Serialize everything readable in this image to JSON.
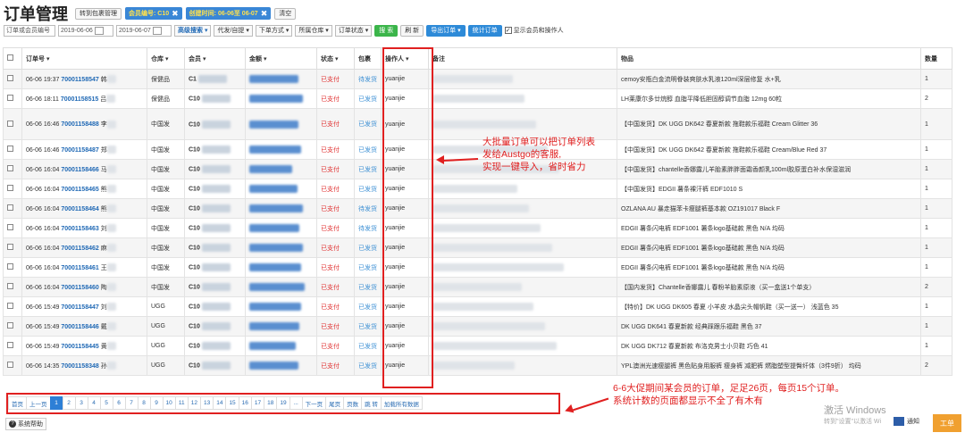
{
  "header": {
    "title": "订单管理",
    "switch_btn": "转到包裹管理",
    "filter_member_label": "会员编号: C10",
    "filter_time_label": "创建时间: 06-06至 06-07",
    "clear_btn": "清空"
  },
  "filters": {
    "order_placeholder": "订单或会员编号",
    "date_from": "2019-06-06",
    "date_to": "2019-06-07",
    "advanced": "高级搜索 ▾",
    "dropdowns": [
      "代发/自提 ▾",
      "下单方式 ▾",
      "所属仓库 ▾",
      "订单状态 ▾"
    ],
    "search_btn": "搜 索",
    "refresh_btn": "刷 新",
    "export_btn": "导出订单 ▾",
    "stats_btn": "统计订单",
    "show_member_label": "显示会员和操作人"
  },
  "table": {
    "columns": [
      "",
      "订单号 ▾",
      "仓库 ▾",
      "会员 ▾",
      "金额 ▾",
      "状态 ▾",
      "包裹",
      "操作人 ▾",
      "备注",
      "物品",
      "数量"
    ],
    "rows": [
      {
        "time": "06-06 19:37",
        "no": "70001158547",
        "name": "韩",
        "wh": "保健品",
        "member": "C1",
        "status": "已支付",
        "pkg": "待发货",
        "op": "yuanjie",
        "item": "cemoy安瓶白金流明眷装爽肤水乳液120ml深层修复 水+乳",
        "qty": "1"
      },
      {
        "time": "06-06 18:11",
        "no": "70001158515",
        "name": "吕",
        "wh": "保健品",
        "member": "C10",
        "status": "已支付",
        "pkg": "已发货",
        "op": "yuanjie",
        "item": "LH莱康尔多廿烷醇 血脂平降低胆固醇调节血脂 12mg 60粒",
        "qty": "2"
      },
      {
        "time": "06-06 16:46",
        "no": "70001158488",
        "name": "李",
        "wh": "中国发",
        "member": "C10",
        "status": "已支付",
        "pkg": "已发货",
        "op": "yuanjie",
        "item": "【中国发货】DK UGG DK642 春夏新款 拖鞋款乐福鞋 Cream Glitter 36",
        "qty": "1"
      },
      {
        "time": "06-06 16:46",
        "no": "70001158487",
        "name": "郑",
        "wh": "中国发",
        "member": "C10",
        "status": "已支付",
        "pkg": "已发货",
        "op": "yuanjie",
        "item": "【中国发货】DK UGG DK642 春夏新款 拖鞋款乐福鞋 Cream/Blue Red 37",
        "qty": "1"
      },
      {
        "time": "06-06 16:04",
        "no": "70001158466",
        "name": "马",
        "wh": "中国发",
        "member": "C10",
        "status": "已支付",
        "pkg": "已发货",
        "op": "yuanjie",
        "item": "【中国发货】chantelle香娜露儿羊胎素胖胖面霜香颜乳100ml胶原蛋白补水保湿滋润",
        "qty": "1"
      },
      {
        "time": "06-06 16:04",
        "no": "70001158465",
        "name": "熊",
        "wh": "中国发",
        "member": "C10",
        "status": "已支付",
        "pkg": "已发货",
        "op": "yuanjie",
        "item": "【中国发货】EDGII 薯条裸汗裤 EDF1010 S",
        "qty": "1"
      },
      {
        "time": "06-06 16:04",
        "no": "70001158464",
        "name": "熊",
        "wh": "中国发",
        "member": "C10",
        "status": "已支付",
        "pkg": "待发货",
        "op": "yuanjie",
        "item": "OZLANA AU 暴走猫苯卡瘦腿裤基本款 OZ191017 Black F",
        "qty": "1"
      },
      {
        "time": "06-06 16:04",
        "no": "70001158463",
        "name": "刘",
        "wh": "中国发",
        "member": "C10",
        "status": "已支付",
        "pkg": "待发货",
        "op": "yuanjie",
        "item": "EDGII 薯条闪电裤 EDF1001 薯条logo基础款 黑色 N/A 均码",
        "qty": "1"
      },
      {
        "time": "06-06 16:04",
        "no": "70001158462",
        "name": "麻",
        "wh": "中国发",
        "member": "C10",
        "status": "已支付",
        "pkg": "已发货",
        "op": "yuanjie",
        "item": "EDGII 薯条闪电裤 EDF1001 薯条logo基础款 黑色 N/A 均码",
        "qty": "1"
      },
      {
        "time": "06-06 16:04",
        "no": "70001158461",
        "name": "王",
        "wh": "中国发",
        "member": "C10",
        "status": "已支付",
        "pkg": "已发货",
        "op": "yuanjie",
        "item": "EDGII 薯条闪电裤 EDF1001 薯条logo基础款 黑色 N/A 均码",
        "qty": "1"
      },
      {
        "time": "06-06 16:04",
        "no": "70001158460",
        "name": "陶",
        "wh": "中国发",
        "member": "C10",
        "status": "已支付",
        "pkg": "已发货",
        "op": "yuanjie",
        "item": "【国内发货】Chantelle香娜露儿 春粉羊胎素原液（买一盒送1个单支）",
        "qty": "2"
      },
      {
        "time": "06-06 15:49",
        "no": "70001158447",
        "name": "刘",
        "wh": "UGG",
        "member": "C10",
        "status": "已支付",
        "pkg": "已发货",
        "op": "yuanjie",
        "item": "【特价】DK UGG DK605 春夏 小羊皮 水晶尖头帽帆鞋（买一送一） 浅蓝色 35",
        "qty": "1"
      },
      {
        "time": "06-06 15:49",
        "no": "70001158446",
        "name": "戴",
        "wh": "UGG",
        "member": "C10",
        "status": "已支付",
        "pkg": "已发货",
        "op": "yuanjie",
        "item": "DK UGG DK641 春夏新款 经典踩跟乐福鞋 黑色 37",
        "qty": "1"
      },
      {
        "time": "06-06 15:49",
        "no": "70001158445",
        "name": "黄",
        "wh": "UGG",
        "member": "C10",
        "status": "已支付",
        "pkg": "已发货",
        "op": "yuanjie",
        "item": "DK UGG DK712 春夏新款 布洛克男士小贝鞋 巧色 41",
        "qty": "1"
      },
      {
        "time": "06-06 14:35",
        "no": "70001158348",
        "name": "孙",
        "wh": "UGG",
        "member": "C10",
        "status": "已支付",
        "pkg": "已发货",
        "op": "yuanjie",
        "item": "YPL澳洲光速瘦腿裤 黑色贴身用服裤 瘦身裤 减肥裤 燃脂塑型提臀纤体（3件9折） 均码",
        "qty": "2"
      }
    ]
  },
  "annotations": {
    "note1": [
      "大批量订单可以把订单列表",
      "发给Austgo的客服,",
      "实现一键导入，省时省力"
    ],
    "note2": [
      "6-6大促期间某会员的订单，足足26页，每页15个订单。",
      "系统计数的页面都显示不全了有木有"
    ]
  },
  "pager": {
    "items": [
      "首页",
      "上一页",
      "1",
      "2",
      "3",
      "4",
      "5",
      "6",
      "7",
      "8",
      "9",
      "10",
      "11",
      "12",
      "13",
      "14",
      "15",
      "16",
      "17",
      "18",
      "19",
      "...",
      "下一页",
      "尾页",
      "页数",
      "跳 转",
      "加载所有数据"
    ]
  },
  "footer": {
    "help": "系统帮助",
    "win_watermark": "激活 Windows",
    "win_watermark2": "转到\"设置\"以激活 Wi",
    "notify": "通知",
    "work": "工单"
  }
}
